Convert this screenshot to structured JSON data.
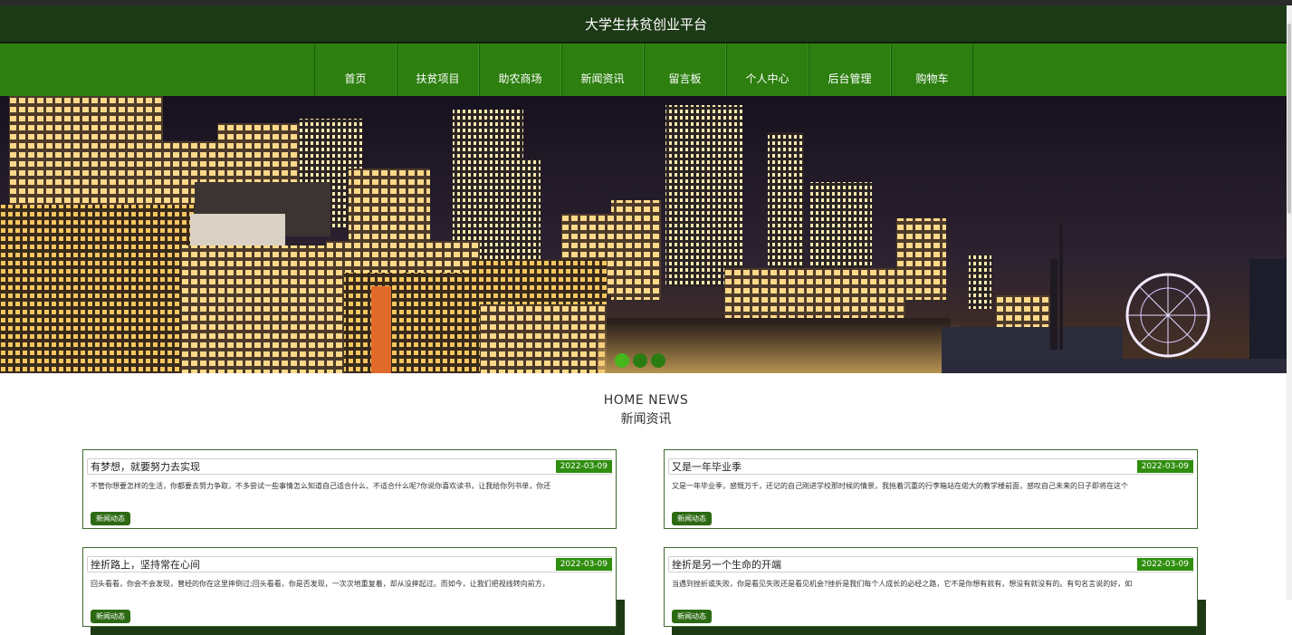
{
  "site": {
    "title": "大学生扶贫创业平台"
  },
  "nav": [
    {
      "label": "首页"
    },
    {
      "label": "扶贫项目"
    },
    {
      "label": "助农商场"
    },
    {
      "label": "新闻资讯"
    },
    {
      "label": "留言板"
    },
    {
      "label": "个人中心"
    },
    {
      "label": "后台管理"
    },
    {
      "label": "购物车"
    }
  ],
  "carousel": {
    "slides": 3,
    "active_index": 0
  },
  "section": {
    "title_en": "HOME NEWS",
    "title_cn": "新闻资讯"
  },
  "news": [
    {
      "title": "有梦想，就要努力去实现",
      "date": "2022-03-09",
      "summary": "不管你想要怎样的生活，你都要去努力争取，不多尝试一些事情怎么知道自己适合什么、不适合什么呢?你说你喜欢读书，让我给你列书单，你还",
      "tag": "新闻动态"
    },
    {
      "title": "又是一年毕业季",
      "date": "2022-03-09",
      "summary": "又是一年毕业季，感慨万千，还记的自己刚进学校那时候的情景，我拖着沉重的行李箱站在偌大的教学楼前面，感叹自己未来的日子即将在这个",
      "tag": "新闻动态"
    },
    {
      "title": "挫折路上，坚持常在心间",
      "date": "2022-03-09",
      "summary": "回头看看，你会不会发现，曾经的你在这里摔倒过;回头看看，你是否发现，一次次地重复着，却从没摔起过。而如今，让我们把视线转向前方，",
      "tag": "新闻动态"
    },
    {
      "title": "挫折是另一个生命的开端",
      "date": "2022-03-09",
      "summary": "当遇到挫折或失败，你是看见失败还是看见机会?挫折是我们每个人成长的必经之路，它不是你想有就有，想没有就没有的。有句名言说的好，如",
      "tag": "新闻动态"
    }
  ],
  "colors": {
    "title_bar": "#1d3a17",
    "nav": "#2d7f10",
    "accent": "#2f8e0e"
  }
}
